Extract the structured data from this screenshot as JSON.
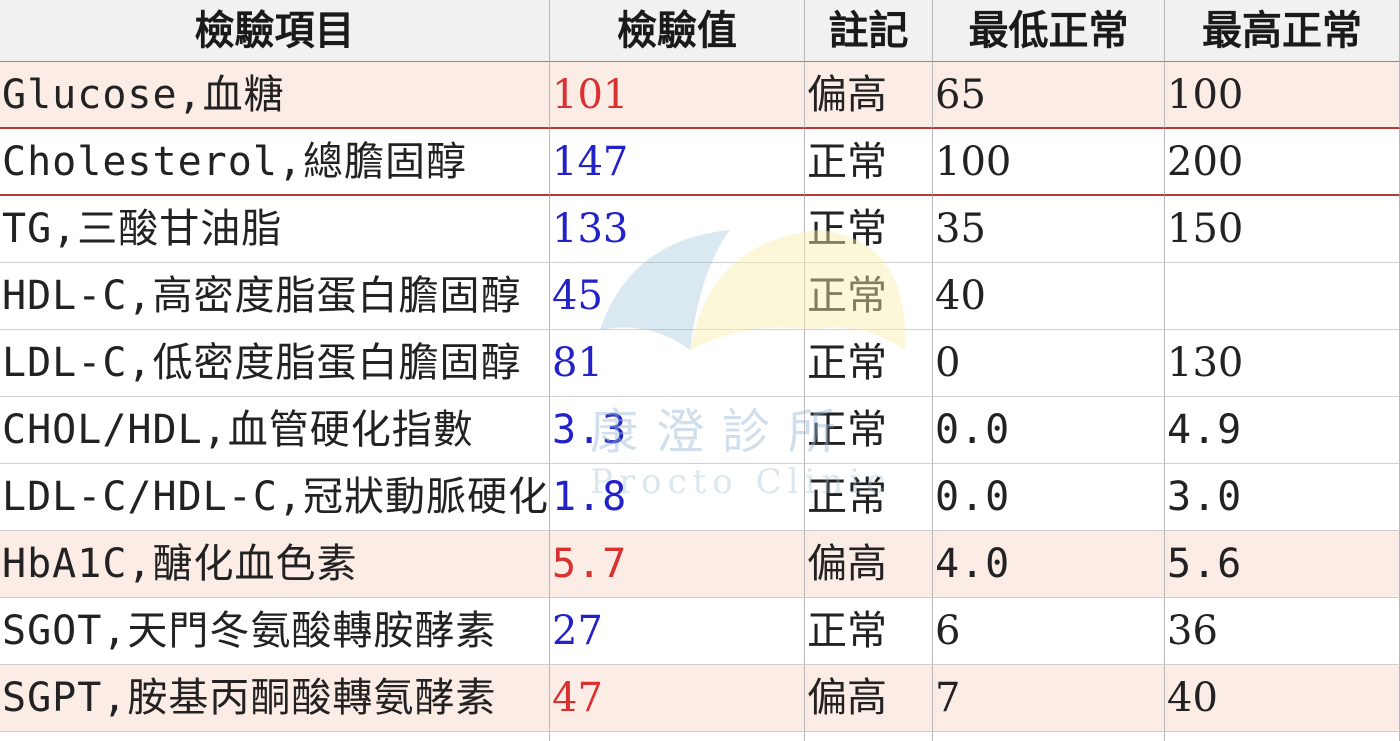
{
  "table": {
    "headers": [
      "檢驗項目",
      "檢驗值",
      "註記",
      "最低正常",
      "最高正常"
    ],
    "rows": [
      {
        "item": "Glucose,血糖",
        "value": "101",
        "note": "偏高",
        "min": "65",
        "max": "100"
      },
      {
        "item": "Cholesterol,總膽固醇",
        "value": "147",
        "note": "正常",
        "min": "100",
        "max": "200"
      },
      {
        "item": "TG,三酸甘油脂",
        "value": "133",
        "note": "正常",
        "min": "35",
        "max": "150"
      },
      {
        "item": "HDL-C,高密度脂蛋白膽固醇",
        "value": "45",
        "note": "正常",
        "min": "40",
        "max": ""
      },
      {
        "item": "LDL-C,低密度脂蛋白膽固醇",
        "value": "81",
        "note": "正常",
        "min": "0",
        "max": "130"
      },
      {
        "item": "CHOL/HDL,血管硬化指數",
        "value": "3.3",
        "note": "正常",
        "min": "0.0",
        "max": "4.9"
      },
      {
        "item": "LDL-C/HDL-C,冠狀動脈硬化",
        "value": "1.8",
        "note": "正常",
        "min": "0.0",
        "max": "3.0"
      },
      {
        "item": "HbA1C,醣化血色素",
        "value": "5.7",
        "note": "偏高",
        "min": "4.0",
        "max": "5.6"
      },
      {
        "item": "SGOT,天門冬氨酸轉胺酵素",
        "value": "27",
        "note": "正常",
        "min": "6",
        "max": "36"
      },
      {
        "item": "SGPT,胺基丙酮酸轉氨酵素",
        "value": "47",
        "note": "偏高",
        "min": "7",
        "max": "40"
      }
    ]
  },
  "watermark": {
    "name_zh": "康澄診所",
    "name_en": "Procto Clinic"
  },
  "colors": {
    "high_value": "#d93030",
    "normal_value": "#2222c8",
    "high_row_bg": "#fcece6",
    "header_bg": "#f1f1f1"
  }
}
